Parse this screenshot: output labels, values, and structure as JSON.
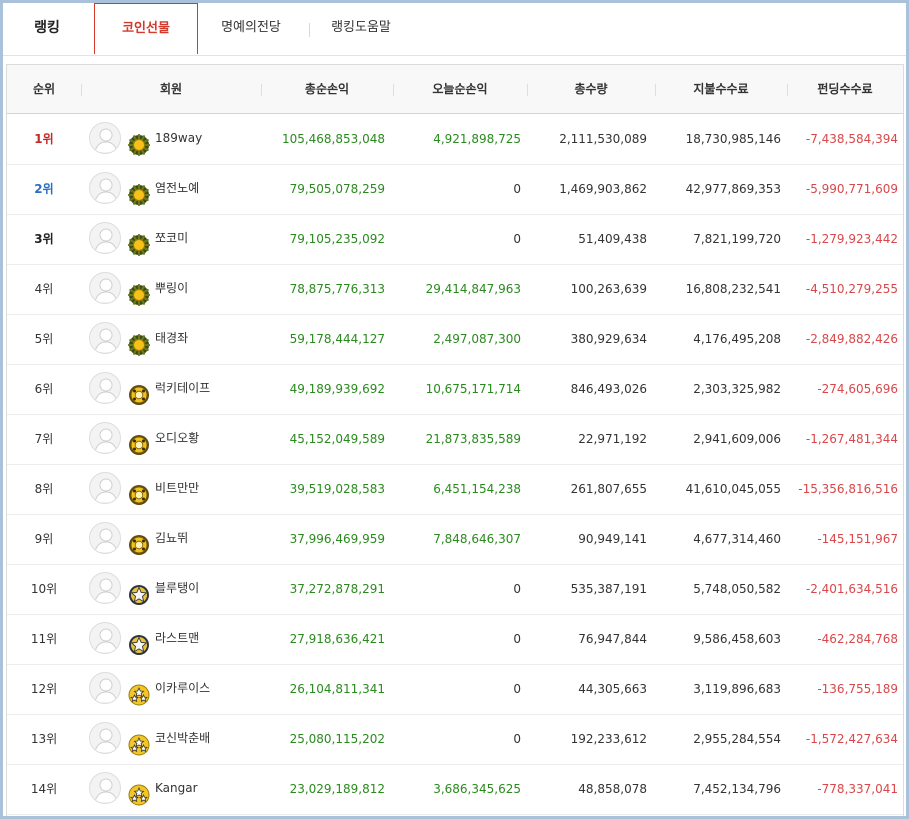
{
  "tabs": [
    {
      "label": "랭킹"
    },
    {
      "label": "코인선물"
    },
    {
      "label": "명예의전당"
    },
    {
      "label": "랭킹도움말"
    }
  ],
  "columns": [
    "순위",
    "회원",
    "총순손익",
    "오늘순손익",
    "총수량",
    "지불수수료",
    "펀딩수수료"
  ],
  "colors": {
    "active_tab": "#d33a2c",
    "profit": "#2a8a1e",
    "loss": "#d9474a",
    "rank1": "#c42a2a",
    "rank2": "#2a6ec4"
  },
  "rows": [
    {
      "rank": "1위",
      "name": "189way",
      "badge": "sun-medal-icon",
      "total": "105,468,853,048",
      "today": "4,921,898,725",
      "qty": "2,111,530,089",
      "fee": "18,730,985,146",
      "funding": "-7,438,584,394"
    },
    {
      "rank": "2위",
      "name": "염전노예",
      "badge": "sun-medal-icon",
      "total": "79,505,078,259",
      "today": "0",
      "qty": "1,469,903,862",
      "fee": "42,977,869,353",
      "funding": "-5,990,771,609"
    },
    {
      "rank": "3위",
      "name": "쪼코미",
      "badge": "sun-medal-icon",
      "total": "79,105,235,092",
      "today": "0",
      "qty": "51,409,438",
      "fee": "7,821,199,720",
      "funding": "-1,279,923,442"
    },
    {
      "rank": "4위",
      "name": "뿌링이",
      "badge": "sun-medal-icon",
      "total": "78,875,776,313",
      "today": "29,414,847,963",
      "qty": "100,263,639",
      "fee": "16,808,232,541",
      "funding": "-4,510,279,255"
    },
    {
      "rank": "5위",
      "name": "태경좌",
      "badge": "sun-medal-icon",
      "total": "59,178,444,127",
      "today": "2,497,087,300",
      "qty": "380,929,634",
      "fee": "4,176,495,208",
      "funding": "-2,849,882,426"
    },
    {
      "rank": "6위",
      "name": "럭키테이프",
      "badge": "moon-medal-icon",
      "total": "49,189,939,692",
      "today": "10,675,171,714",
      "qty": "846,493,026",
      "fee": "2,303,325,982",
      "funding": "-274,605,696"
    },
    {
      "rank": "7위",
      "name": "오디오황",
      "badge": "moon-medal-icon",
      "total": "45,152,049,589",
      "today": "21,873,835,589",
      "qty": "22,971,192",
      "fee": "2,941,609,006",
      "funding": "-1,267,481,344"
    },
    {
      "rank": "8위",
      "name": "비트만만",
      "badge": "moon-medal-icon",
      "total": "39,519,028,583",
      "today": "6,451,154,238",
      "qty": "261,807,655",
      "fee": "41,610,045,055",
      "funding": "-15,356,816,516"
    },
    {
      "rank": "9위",
      "name": "김뇨뛰",
      "badge": "moon-medal-icon",
      "total": "37,996,469,959",
      "today": "7,848,646,307",
      "qty": "90,949,141",
      "fee": "4,677,314,460",
      "funding": "-145,151,967"
    },
    {
      "rank": "10위",
      "name": "블루탱이",
      "badge": "star-medal-icon",
      "total": "37,272,878,291",
      "today": "0",
      "qty": "535,387,191",
      "fee": "5,748,050,582",
      "funding": "-2,401,634,516"
    },
    {
      "rank": "11위",
      "name": "라스트맨",
      "badge": "star-medal-icon",
      "total": "27,918,636,421",
      "today": "0",
      "qty": "76,947,844",
      "fee": "9,586,458,603",
      "funding": "-462,284,768"
    },
    {
      "rank": "12위",
      "name": "이카루이스",
      "badge": "triple-star-medal-icon",
      "total": "26,104,811,341",
      "today": "0",
      "qty": "44,305,663",
      "fee": "3,119,896,683",
      "funding": "-136,755,189"
    },
    {
      "rank": "13위",
      "name": "코신박춘배",
      "badge": "triple-star-medal-icon",
      "total": "25,080,115,202",
      "today": "0",
      "qty": "192,233,612",
      "fee": "2,955,284,554",
      "funding": "-1,572,427,634"
    },
    {
      "rank": "14위",
      "name": "Kangar",
      "badge": "triple-star-medal-icon",
      "total": "23,029,189,812",
      "today": "3,686,345,625",
      "qty": "48,858,078",
      "fee": "7,452,134,796",
      "funding": "-778,337,041"
    }
  ]
}
